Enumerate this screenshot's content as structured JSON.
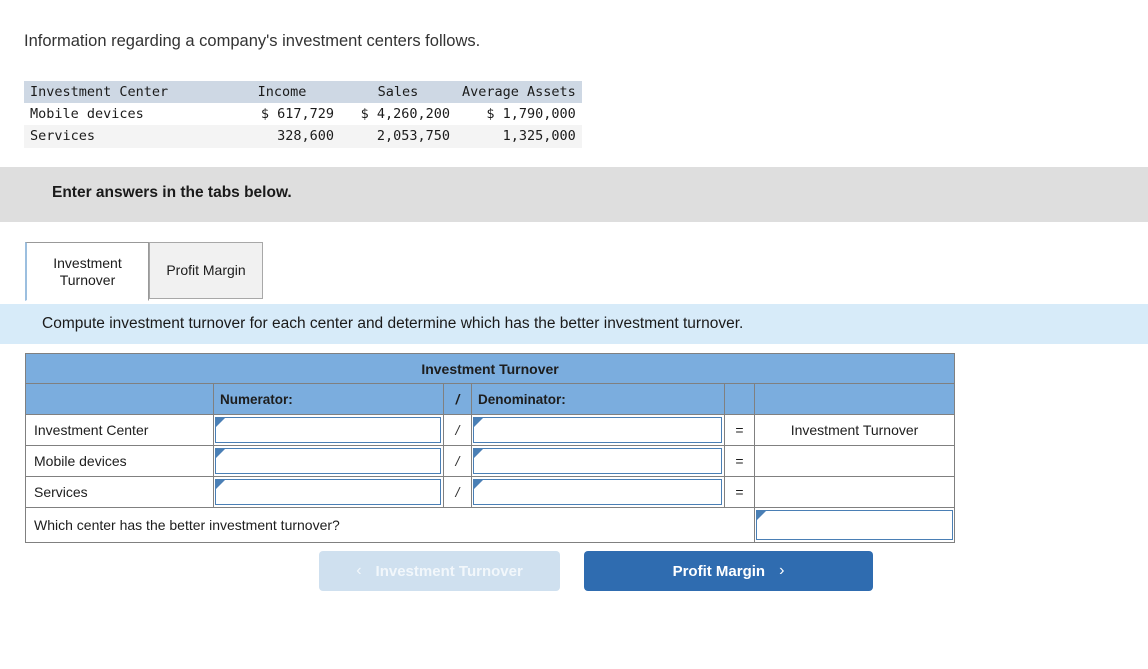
{
  "intro_text": "Information regarding a company's investment centers follows.",
  "given_table": {
    "headers": [
      "Investment Center",
      "Income",
      "Sales",
      "Average Assets"
    ],
    "rows": [
      {
        "center": "Mobile devices",
        "income": "$ 617,729",
        "sales": "$ 4,260,200",
        "average_assets": "$ 1,790,000"
      },
      {
        "center": "Services",
        "income": "328,600",
        "sales": "2,053,750",
        "average_assets": "1,325,000"
      }
    ]
  },
  "enter_banner": {
    "text": "Enter answers in the tabs below."
  },
  "tabs": [
    {
      "label": "Investment Turnover",
      "active": true
    },
    {
      "label": "Profit Margin",
      "active": false
    }
  ],
  "instruction": "Compute investment turnover for each center and determine which has the better investment turnover.",
  "answer_grid": {
    "title": "Investment Turnover",
    "column_headers": {
      "row_label": "",
      "numerator": "Numerator:",
      "slash": "/",
      "denominator": "Denominator:",
      "equals": "",
      "result": ""
    },
    "rows": [
      {
        "label": "Investment Center",
        "numerator": "",
        "slash": "/",
        "denominator": "",
        "equals": "=",
        "result": "Investment Turnover"
      },
      {
        "label": "Mobile devices",
        "numerator": "",
        "slash": "/",
        "denominator": "",
        "equals": "=",
        "result": ""
      },
      {
        "label": "Services",
        "numerator": "",
        "slash": "/",
        "denominator": "",
        "equals": "=",
        "result": ""
      }
    ],
    "question_row": {
      "question": "Which center has the better investment turnover?",
      "answer": ""
    }
  },
  "nav": {
    "prev_label": "Investment Turnover",
    "prev_chevron": "‹",
    "next_label": "Profit Margin",
    "next_chevron": "›"
  },
  "colors": {
    "header_blue": "#7badde",
    "banner_blue": "#d7ebf9",
    "banner_gray": "#dedede",
    "button_blue": "#2f6cb0",
    "button_disabled": "#cfe0ef",
    "input_border": "#4a7fb5"
  }
}
